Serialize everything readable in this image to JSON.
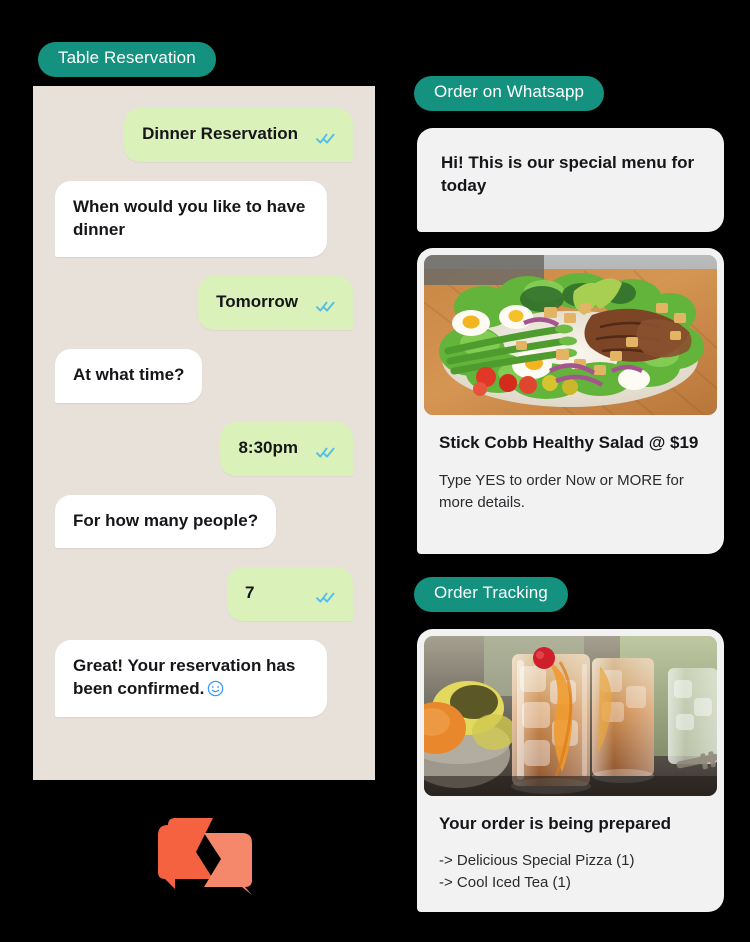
{
  "theme": {
    "background": "#000000",
    "badge_bg": "#14917f",
    "badge_text": "#ffffff",
    "chat_panel_bg": "#e8e1da",
    "bubble_in_bg": "#ffffff",
    "bubble_out_bg": "#daf2b9",
    "card_bg": "#f2f2f2",
    "tick_color": "#53bdeb",
    "logo_color_left": "#f4623f",
    "logo_color_right": "#f5876a",
    "text_color": "#16161a"
  },
  "sections": {
    "table_reservation": {
      "badge_label": "Table Reservation",
      "messages": [
        {
          "side": "out",
          "text": "Dinner Reservation",
          "ticks": "double-check-icon"
        },
        {
          "side": "in",
          "text": "When would you like to have dinner"
        },
        {
          "side": "out",
          "text": "Tomorrow",
          "ticks": "double-check-icon"
        },
        {
          "side": "in",
          "text": "At what time?"
        },
        {
          "side": "out",
          "text": "8:30pm",
          "ticks": "double-check-icon"
        },
        {
          "side": "in",
          "text": "For how many people?"
        },
        {
          "side": "out",
          "text": "7",
          "ticks": "double-check-icon"
        },
        {
          "side": "in",
          "text": "Great! Your reservation has been confirmed.",
          "emoji": "smiley-face-icon"
        }
      ]
    },
    "order_on_whatsapp": {
      "badge_label": "Order on Whatsapp",
      "greeting_card": {
        "text": "Hi! This is our special menu for today"
      },
      "product_card": {
        "image_alt": "cobb-salad-photo",
        "title": "Stick Cobb Healthy Salad @ $19",
        "subtitle": "Type YES to order Now or MORE for more details."
      }
    },
    "order_tracking": {
      "badge_label": "Order Tracking",
      "tracking_card": {
        "image_alt": "iced-tea-photo",
        "title": "Your order is being prepared",
        "items": [
          "-> Delicious Special Pizza (1)",
          "-> Cool Iced Tea (1)"
        ]
      }
    }
  },
  "brand": {
    "logo_name": "chat-bubbles-logo"
  }
}
